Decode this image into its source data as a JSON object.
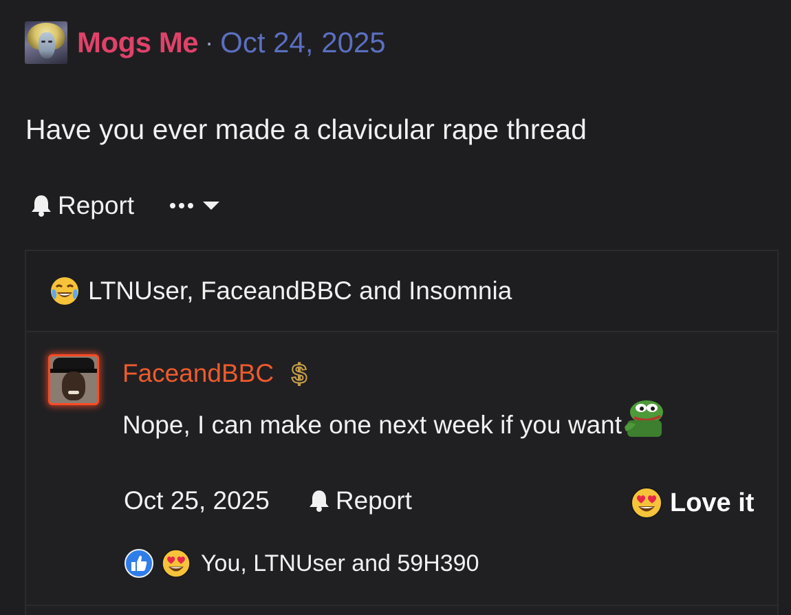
{
  "post": {
    "author": "Mogs Me",
    "separator": "·",
    "date": "Oct 24, 2025",
    "body": "Have you ever made a clavicular rape thread",
    "actions": {
      "report_label": "Report",
      "report_icon": "bell-icon",
      "more_icon": "more-dots-icon"
    }
  },
  "reactions_summary": {
    "emoji": "crying-laughing-emoji",
    "users": "LTNUser, FaceandBBC and Insomnia"
  },
  "reply": {
    "author": "FaceandBBC",
    "badge_icon": "dollar-sign-icon",
    "text": "Nope, I can make one next week if you want",
    "inline_emoji": "pepe-emoji",
    "date": "Oct 25, 2025",
    "report_label": "Report",
    "love_label": "Love it",
    "love_emoji": "heart-eyes-emoji",
    "reactions": {
      "icons": [
        "thumbs-up-icon",
        "heart-eyes-emoji"
      ],
      "users": "You, LTNUser and 59H390"
    }
  },
  "colors": {
    "background": "#1e1e20",
    "author_name": "#e0426a",
    "post_date": "#5b6fc1",
    "reply_author": "#ee5b2c",
    "avatar_glow": "#ff4a24",
    "text": "#f1f1f1"
  }
}
